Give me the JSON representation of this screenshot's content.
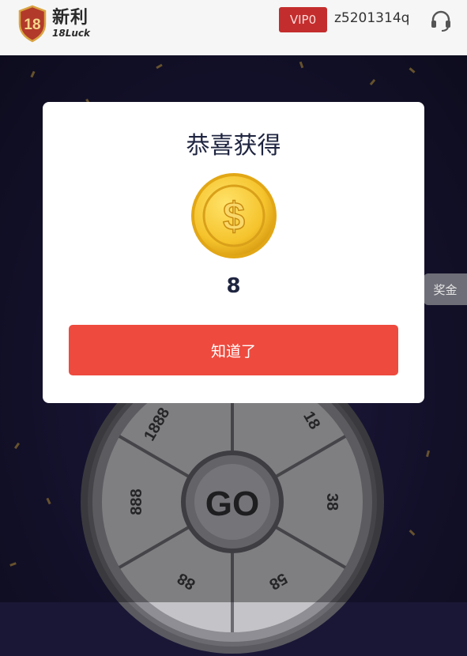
{
  "header": {
    "logo_cn": "新利",
    "logo_en": "18Luck",
    "logo_numeral": "18",
    "vip_label": "VIP0",
    "username": "z5201314q",
    "support_icon": "headset-icon"
  },
  "side_tab": {
    "label": "奖金"
  },
  "wheel": {
    "center_label": "GO",
    "segments": [
      "18",
      "38",
      "58",
      "88",
      "888",
      "1888"
    ]
  },
  "modal": {
    "title": "恭喜获得",
    "coin_icon": "dollar-coin-icon",
    "prize_amount": "8",
    "confirm_label": "知道了"
  },
  "colors": {
    "accent_red": "#ee4a3e",
    "vip_red": "#c42d2d",
    "coin_gold": "#f5c32c",
    "dark_text": "#1f2540"
  }
}
